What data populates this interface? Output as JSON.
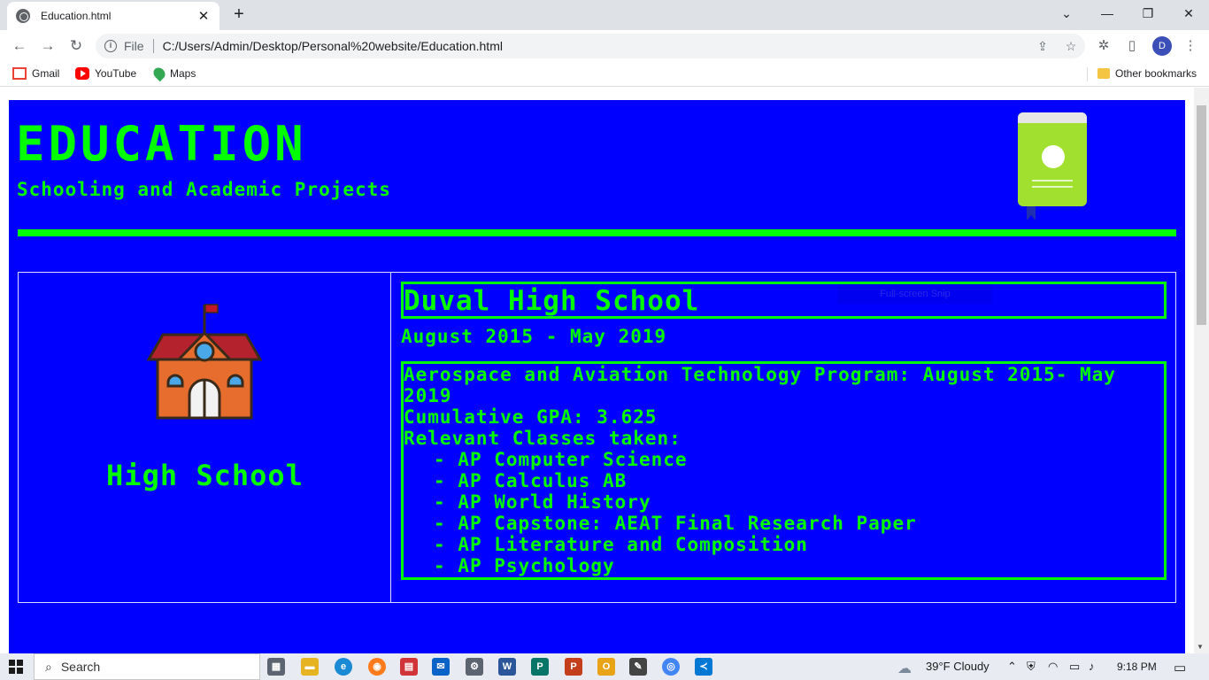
{
  "browser": {
    "tab_title": "Education.html",
    "omnibox_label": "File",
    "url": "C:/Users/Admin/Desktop/Personal%20website/Education.html",
    "profile_initial": "D",
    "bookmarks": [
      {
        "label": "Gmail",
        "icon": "gmail-icon"
      },
      {
        "label": "YouTube",
        "icon": "youtube-icon"
      },
      {
        "label": "Maps",
        "icon": "maps-icon"
      }
    ],
    "other_bookmarks": "Other bookmarks"
  },
  "page": {
    "title": "EDUCATION",
    "subtitle": "Schooling and Academic Projects",
    "colors": {
      "background": "#0000ff",
      "text": "#00ff00",
      "book": "#a2e030"
    },
    "entry": {
      "label": "High School",
      "school_name": "Duval High School",
      "date_range": "August 2015 - May 2019",
      "program": "Aerospace and Aviation Technology Program: August 2015- May 2019",
      "gpa": "Cumulative GPA: 3.625",
      "classes_heading": "Relevant Classes taken:",
      "classes": [
        "AP Computer Science",
        "AP Calculus AB",
        "AP World History",
        "AP Capstone: AEAT Final Research Paper",
        "AP Literature and Composition",
        "AP Psychology"
      ]
    },
    "snip_overlay": "Full-screen Snip"
  },
  "taskbar": {
    "search_placeholder": "Search",
    "weather": "39°F  Cloudy",
    "time": "9:18 PM"
  }
}
